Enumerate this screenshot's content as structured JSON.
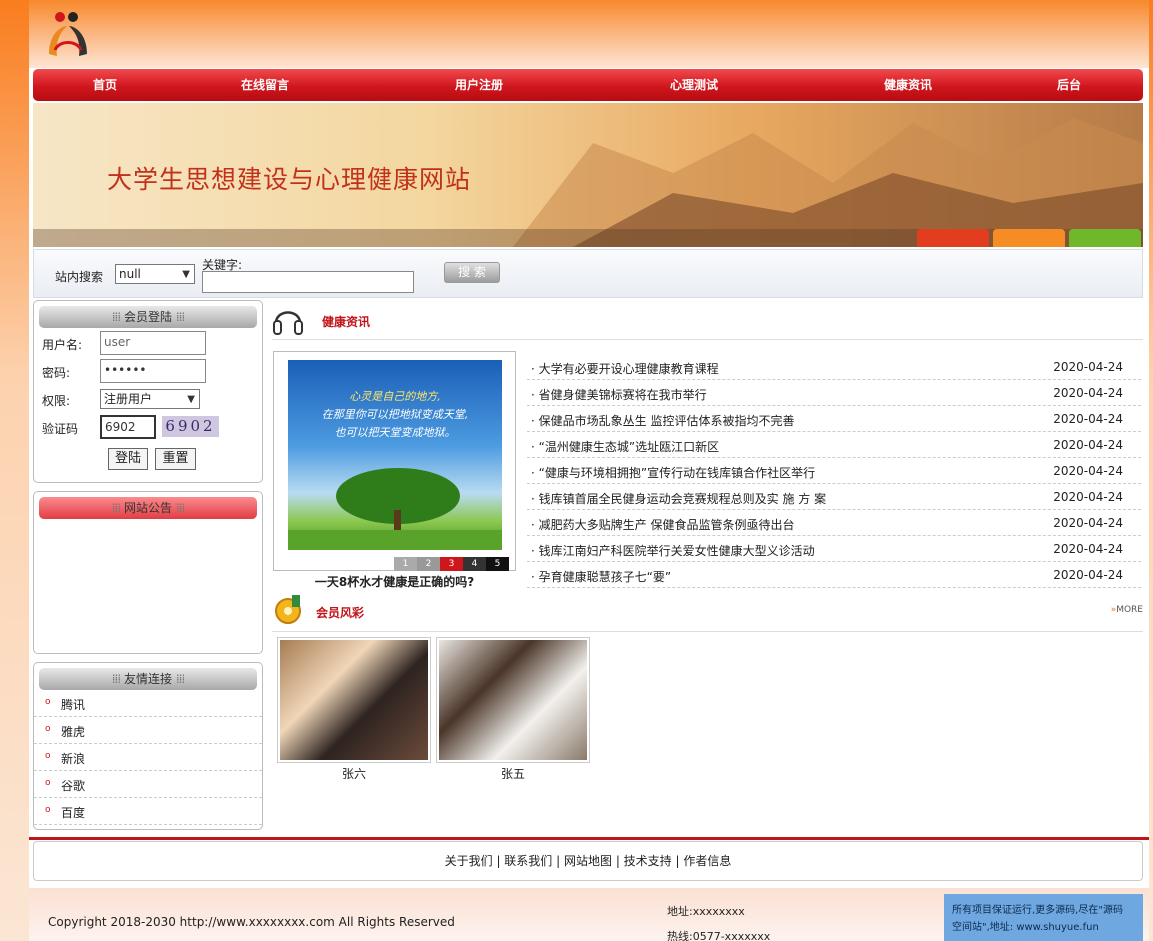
{
  "nav": {
    "items": [
      "首页",
      "在线留言",
      "用户注册",
      "心理测试",
      "健康资讯",
      "后台"
    ]
  },
  "banner": {
    "title": "大学生思想建设与心理健康网站"
  },
  "search": {
    "site_search_label": "站内搜索",
    "select_value": "null",
    "keyword_label": "关键字:",
    "keyword_value": "",
    "button_label": "搜 索"
  },
  "login": {
    "title": "会员登陆",
    "username_label": "用户名:",
    "username_value": "user",
    "password_label": "密码:",
    "password_value": "••••••",
    "role_label": "权限:",
    "role_value": "注册用户",
    "captcha_label": "验证码",
    "captcha_value": "6902",
    "captcha_image": "6902",
    "login_button": "登陆",
    "reset_button": "重置"
  },
  "notice": {
    "title": "网站公告"
  },
  "friend_links": {
    "title": "友情连接",
    "items": [
      "腾讯",
      "雅虎",
      "新浪",
      "谷歌",
      "百度"
    ]
  },
  "health_news": {
    "title": "健康资讯",
    "feature_caption": "一天8杯水才健康是正确的吗?",
    "slide_pages": [
      "1",
      "2",
      "3",
      "4",
      "5"
    ],
    "slide_text": [
      "心灵是自己的地方,",
      "在那里你可以把地狱变成天堂,",
      "也可以把天堂变成地狱。"
    ],
    "items": [
      {
        "title": "· 大学有必要开设心理健康教育课程",
        "date": "2020-04-24"
      },
      {
        "title": "· 省健身健美锦标赛将在我市举行",
        "date": "2020-04-24"
      },
      {
        "title": "· 保健品市场乱象丛生 监控评估体系被指均不完善",
        "date": "2020-04-24"
      },
      {
        "title": "· “温州健康生态城”选址瓯江口新区",
        "date": "2020-04-24"
      },
      {
        "title": "· “健康与环境相拥抱”宣传行动在钱库镇合作社区举行",
        "date": "2020-04-24"
      },
      {
        "title": "· 钱库镇首届全民健身运动会竞赛规程总则及实 施 方 案",
        "date": "2020-04-24"
      },
      {
        "title": "· 减肥药大多贴牌生产 保健食品监管条例亟待出台",
        "date": "2020-04-24"
      },
      {
        "title": "· 钱库江南妇产科医院举行关爱女性健康大型义诊活动",
        "date": "2020-04-24"
      },
      {
        "title": "· 孕育健康聪慧孩子七“要”",
        "date": "2020-04-24"
      }
    ]
  },
  "members": {
    "title": "会员风彩",
    "more": "MORE",
    "items": [
      {
        "name": "张六"
      },
      {
        "name": "张五"
      }
    ]
  },
  "footer": {
    "links": [
      "关于我们",
      "联系我们",
      "网站地图",
      "技术支持",
      "作者信息"
    ],
    "separator": " | ",
    "copyright": "Copyright 2018-2030 http://www.xxxxxxxx.com All Rights Reserved",
    "address_label": "地址:",
    "address_value": "xxxxxxxx",
    "hotline_label": "热线:",
    "hotline_value": "0577-xxxxxxx",
    "ad_line1": "所有项目保证运行,更多源码,尽在\"源码",
    "ad_line2": "空间站\",地址: www.shuyue.fun"
  },
  "colors": {
    "accent": "#d0161d",
    "link_title": "#c2141b",
    "banner_text": "#c0321c"
  }
}
